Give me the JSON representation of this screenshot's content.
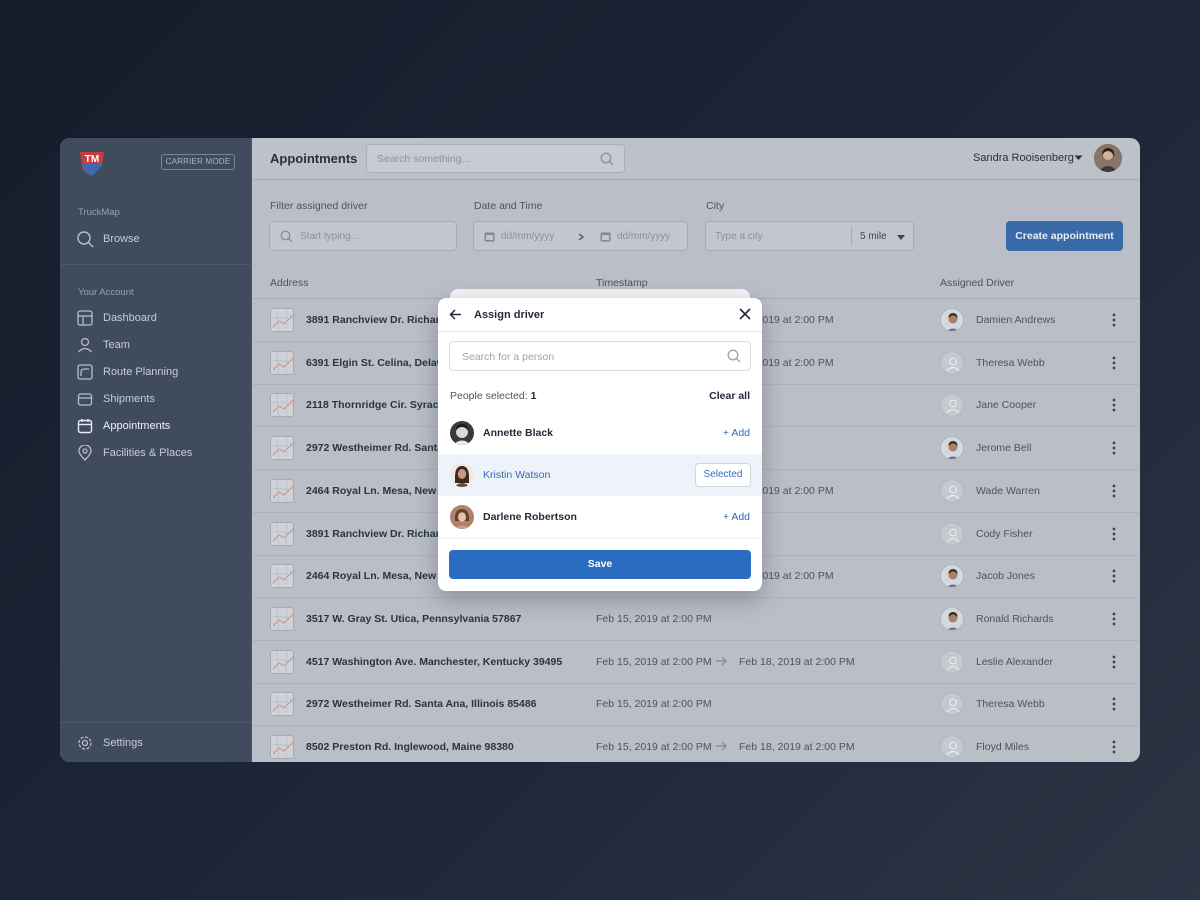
{
  "sidebar": {
    "logo_text": "TM",
    "mode_badge": "CARRIER MODE",
    "section_brand": "TruckMap",
    "browse": "Browse",
    "section_account": "Your Account",
    "items": [
      {
        "label": "Dashboard",
        "icon": "dashboard-icon"
      },
      {
        "label": "Team",
        "icon": "user-icon"
      },
      {
        "label": "Route Planning",
        "icon": "route-icon"
      },
      {
        "label": "Shipments",
        "icon": "box-icon"
      },
      {
        "label": "Appointments",
        "icon": "calendar-icon",
        "active": true
      },
      {
        "label": "Facilities & Places",
        "icon": "location-pin-icon"
      }
    ],
    "settings": "Settings"
  },
  "header": {
    "title": "Appointments",
    "search_placeholder": "Search something...",
    "user_name": "Sandra Rooisenberg"
  },
  "filters": {
    "driver_label": "Filter assigned driver",
    "driver_placeholder": "Start typing...",
    "date_label": "Date and Time",
    "date_from": "dd/mm/yyyy",
    "date_to": "dd/mm/yyyy",
    "city_label": "City",
    "city_placeholder": "Type a city",
    "radius": "5 mile",
    "create_button": "Create appointment"
  },
  "table": {
    "headers": {
      "address": "Address",
      "timestamp": "Timestamp",
      "driver": "Assigned Driver"
    },
    "rows": [
      {
        "address": "3891 Ranchview Dr. Richardson, California 62639",
        "ts1": "",
        "ts2": "Feb 18, 2019 at 2:00 PM",
        "ts2_visible": "18, 2019 at 2:00 PM",
        "driver": "Damien Andrews",
        "photo": true
      },
      {
        "address": "6391 Elgin St. Celina, Delaware 10299",
        "ts1": "",
        "ts2_visible": "18, 2019 at 2:00 PM",
        "driver": "Theresa Webb",
        "photo": false
      },
      {
        "address": "2118 Thornridge Cir. Syracuse, Connecticut 35624",
        "ts1": "",
        "ts2_visible": "",
        "driver": "Jane Cooper",
        "photo": false
      },
      {
        "address": "2972 Westheimer Rd. Santa Ana, Illinois 85486",
        "ts1": "",
        "ts2_visible": "",
        "driver": "Jerome Bell",
        "photo": true
      },
      {
        "address": "2464 Royal Ln. Mesa, New Jersey 45463",
        "ts1": "",
        "ts2_visible": "18, 2019 at 2:00 PM",
        "driver": "Wade Warren",
        "photo": false
      },
      {
        "address": "3891 Ranchview Dr. Richardson, California 62639",
        "ts1": "",
        "ts2_visible": "",
        "driver": "Cody Fisher",
        "photo": false
      },
      {
        "address": "2464 Royal Ln. Mesa, New Jersey 45463",
        "ts1": "",
        "ts2_visible": "18, 2019 at 2:00 PM",
        "driver": "Jacob Jones",
        "photo": true
      },
      {
        "address": "3517 W. Gray St. Utica, Pennsylvania 57867",
        "ts1": "Feb 15, 2019 at 2:00 PM",
        "ts2_visible": "",
        "driver": "Ronald Richards",
        "photo": true
      },
      {
        "address": "4517 Washington Ave. Manchester, Kentucky 39495",
        "ts1": "Feb 15, 2019 at 2:00 PM",
        "ts2_visible": "Feb 18, 2019 at 2:00 PM",
        "driver": "Leslie Alexander",
        "photo": false
      },
      {
        "address": "2972 Westheimer Rd. Santa Ana, Illinois 85486",
        "ts1": "Feb 15, 2019 at 2:00 PM",
        "ts2_visible": "",
        "driver": "Theresa Webb",
        "photo": false
      },
      {
        "address": "8502 Preston Rd. Inglewood, Maine 98380",
        "ts1": "Feb 15, 2019 at 2:00 PM",
        "ts2_visible": "Feb 18, 2019 at 2:00 PM",
        "driver": "Floyd Miles",
        "photo": false
      }
    ]
  },
  "modal": {
    "title": "Assign driver",
    "search_placeholder": "Search for a person",
    "selected_label": "People selected:",
    "selected_count": "1",
    "clear_all": "Clear all",
    "people": [
      {
        "name": "Annette Black",
        "action": "+ Add",
        "selected": false
      },
      {
        "name": "Kristin Watson",
        "action": "Selected",
        "selected": true
      },
      {
        "name": "Darlene Robertson",
        "action": "+ Add",
        "selected": false
      }
    ],
    "save": "Save"
  },
  "colors": {
    "accent": "#2a6cc0",
    "sidebar": "#404b5d",
    "overlay": "#b9bec7"
  }
}
